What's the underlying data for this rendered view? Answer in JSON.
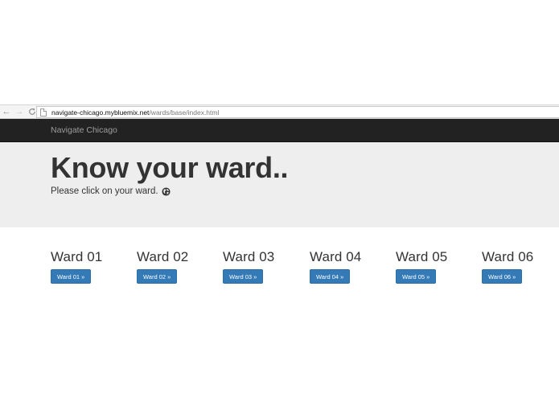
{
  "browser": {
    "url_host": "navigate-chicago.mybluemix.net",
    "url_path": "/wards/base/index.html",
    "back_glyph": "←",
    "forward_glyph": "→"
  },
  "navbar": {
    "brand": "Navigate Chicago"
  },
  "jumbotron": {
    "title": "Know your ward..",
    "lead": "Please click on your ward.",
    "lead_icon": "globe-icon"
  },
  "wards": [
    {
      "title": "Ward 01",
      "button": "Ward 01 »"
    },
    {
      "title": "Ward 02",
      "button": "Ward 02 »"
    },
    {
      "title": "Ward 03",
      "button": "Ward 03 »"
    },
    {
      "title": "Ward 04",
      "button": "Ward 04 »"
    },
    {
      "title": "Ward 05",
      "button": "Ward 05 »"
    },
    {
      "title": "Ward 06",
      "button": "Ward 06 »"
    }
  ],
  "colors": {
    "navbar_bg": "#222222",
    "jumbotron_bg": "#eeeeee",
    "button_primary": "#337ab7"
  }
}
